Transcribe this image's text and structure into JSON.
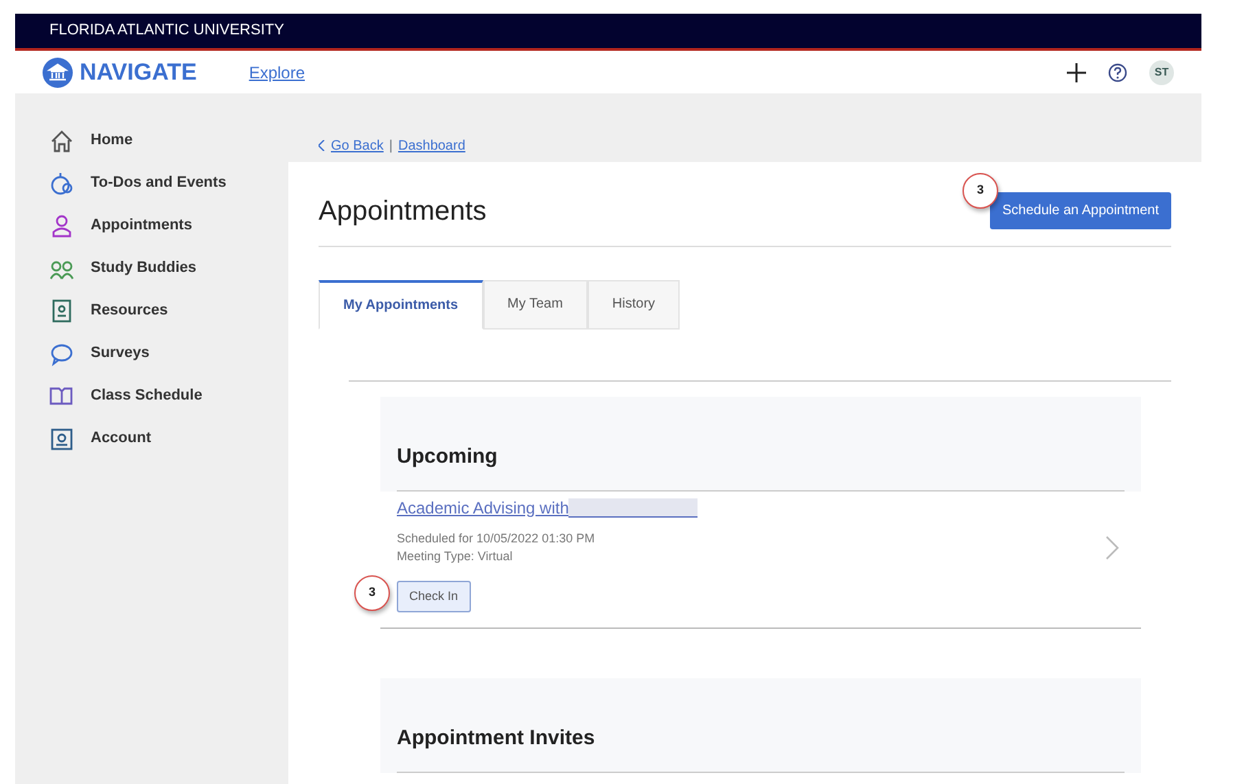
{
  "top_bar": {
    "title": "FLORIDA ATLANTIC UNIVERSITY"
  },
  "header": {
    "logo": "NAVIGATE",
    "links": [
      {
        "label": "Explore"
      }
    ],
    "avatar": "ST"
  },
  "sidebar": {
    "items": [
      {
        "label": "Home",
        "kind": "home",
        "color": "#555555"
      },
      {
        "label": "To-Dos and Events",
        "kind": "todo",
        "color": "#3b6fd0"
      },
      {
        "label": "Appointments",
        "kind": "person",
        "color": "#a335c9"
      },
      {
        "label": "Study Buddies",
        "kind": "people",
        "color": "#4a9a55"
      },
      {
        "label": "Resources",
        "kind": "board",
        "color": "#2e6b5e"
      },
      {
        "label": "Surveys",
        "kind": "bubble",
        "color": "#3b6fd0"
      },
      {
        "label": "Class Schedule",
        "kind": "book",
        "color": "#6c5bc0"
      },
      {
        "label": "Account",
        "kind": "card",
        "color": "#2d5d8a"
      }
    ]
  },
  "breadcrumb": {
    "back": "Go Back",
    "separator": "|",
    "current": "Dashboard"
  },
  "page": {
    "title": "Appointments",
    "action": {
      "label": "Schedule an Appointment",
      "callout": "3"
    },
    "tabs": [
      {
        "label": "My Appointments",
        "selected": true
      },
      {
        "label": "My Team",
        "selected": false
      },
      {
        "label": "History",
        "selected": false
      }
    ],
    "sections": [
      {
        "title": "Upcoming",
        "appointments": [
          {
            "title": "Academic Advising with",
            "redacted": true,
            "scheduled": "Scheduled for 10/05/2022 01:30 PM",
            "meeting_type": "Meeting Type: Virtual",
            "button": "Check In",
            "callout": "3"
          }
        ]
      },
      {
        "title": "Appointment Invites"
      }
    ]
  }
}
